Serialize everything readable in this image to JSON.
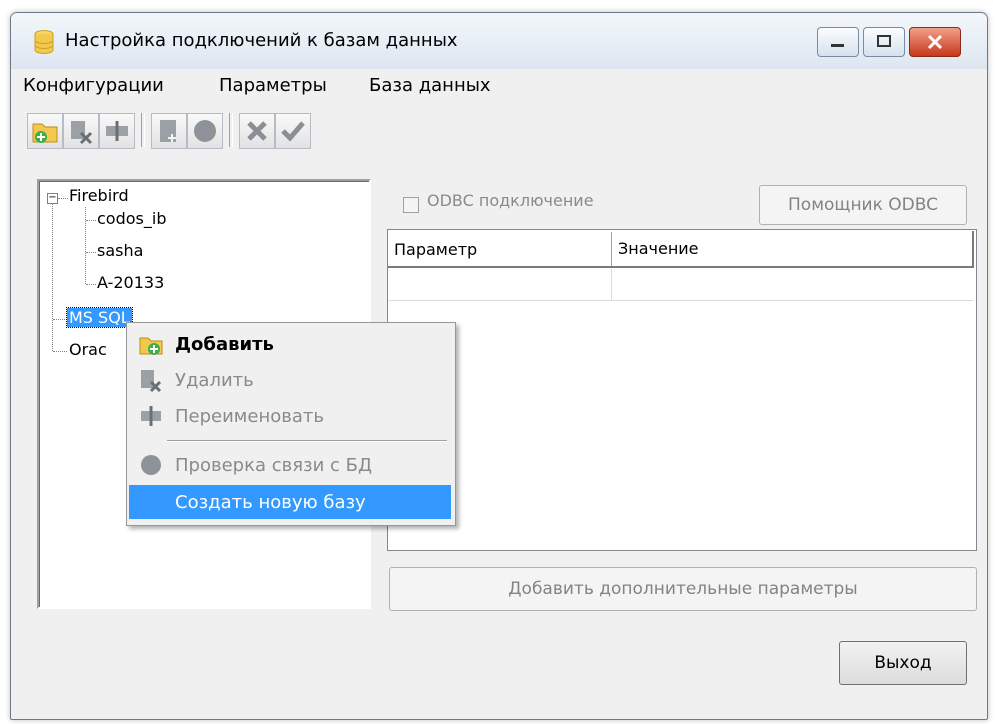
{
  "window": {
    "title": "Настройка подключений к базам данных"
  },
  "menu": [
    "Конфигурации",
    "Параметры",
    "База данных"
  ],
  "tree": {
    "root_firebird": "Firebird",
    "firebird_children": [
      "codos_ib",
      "sasha",
      "A-20133"
    ],
    "ms_sql": "MS SQL",
    "oracle": "Orac"
  },
  "odbc": {
    "checkbox_label": "ODBC подключение",
    "helper_button": "Помощник ODBC"
  },
  "grid": {
    "columns": [
      "Параметр",
      "Значение"
    ]
  },
  "buttons": {
    "add_params": "Добавить дополнительные параметры",
    "exit": "Выход"
  },
  "context_menu": {
    "items": [
      {
        "label": "Добавить",
        "icon": "folder-add-icon",
        "enabled": true,
        "bold": true
      },
      {
        "label": "Удалить",
        "icon": "delete-db-icon",
        "enabled": false
      },
      {
        "label": "Переименовать",
        "icon": "rename-icon",
        "enabled": false
      },
      {
        "label": "Проверка связи с БД",
        "icon": "connection-check-icon",
        "enabled": false
      },
      {
        "label": "Создать новую базу",
        "icon": "",
        "enabled": true,
        "highlighted": true
      }
    ]
  },
  "colors": {
    "selection": "#3399ff",
    "close_button": "#c8371c"
  }
}
